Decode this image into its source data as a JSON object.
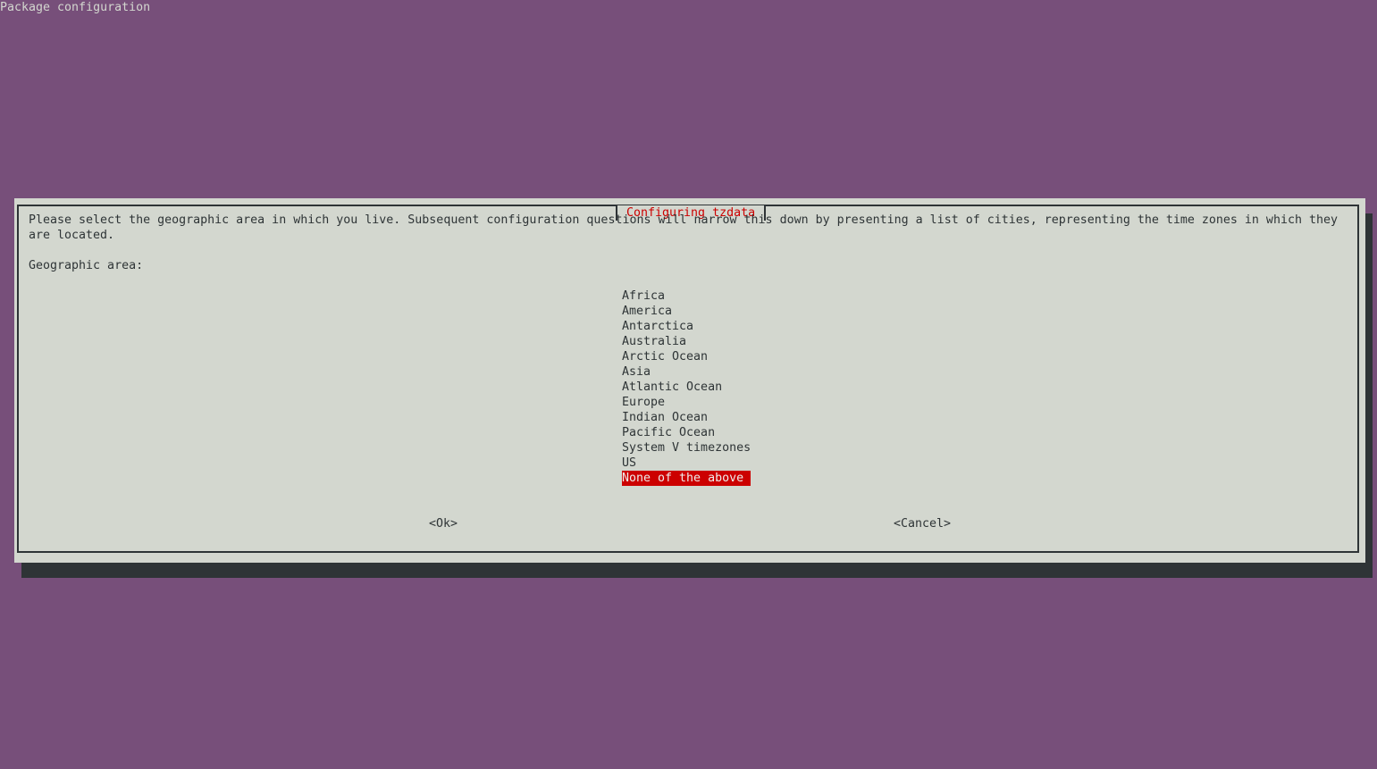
{
  "backtitle": "Package configuration",
  "dialog": {
    "title": "Configuring tzdata",
    "prompt": "Please select the geographic area in which you live. Subsequent configuration questions will narrow this down by presenting a list of cities, representing the time zones in which they\nare located.",
    "list_label": "Geographic area:",
    "options": [
      "Africa",
      "America",
      "Antarctica",
      "Australia",
      "Arctic Ocean",
      "Asia",
      "Atlantic Ocean",
      "Europe",
      "Indian Ocean",
      "Pacific Ocean",
      "System V timezones",
      "US",
      "None of the above"
    ],
    "selected_index": 12,
    "ok_label": "<Ok>",
    "cancel_label": "<Cancel>"
  },
  "colors": {
    "background": "#774f7a",
    "dialog": "#d3d7cf",
    "shadow": "#2e3436",
    "highlight": "#cc0000",
    "title": "#cc0000"
  }
}
